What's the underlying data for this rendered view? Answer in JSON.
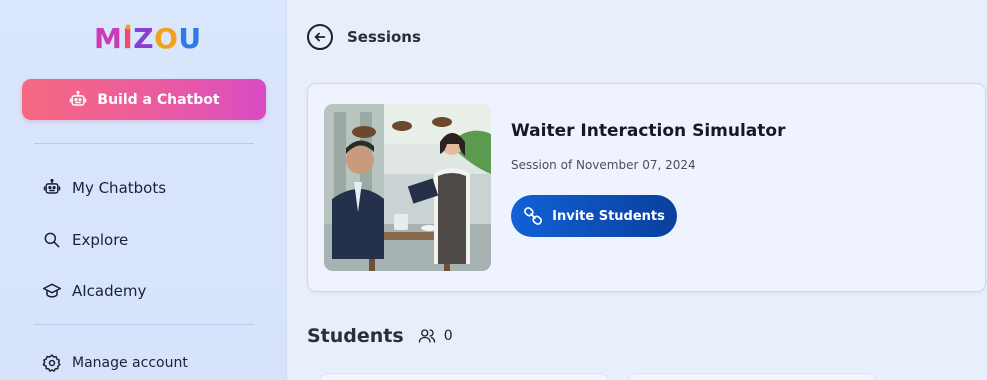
{
  "sidebar": {
    "logo": {
      "text": "MIZOU"
    },
    "build_button": {
      "label": "Build a Chatbot",
      "icon": "robot-icon"
    },
    "items": [
      {
        "label": "My Chatbots",
        "icon": "robot-icon"
      },
      {
        "label": "Explore",
        "icon": "search-icon"
      },
      {
        "label": "AIcademy",
        "icon": "graduation-cap-icon"
      },
      {
        "label": "Manage account",
        "icon": "gear-icon"
      }
    ]
  },
  "topbar": {
    "back_icon": "arrow-left-circle-icon",
    "title": "Sessions"
  },
  "session": {
    "title": "Waiter Interaction Simulator",
    "subtitle": "Session of November 07, 2024",
    "invite_label": "Invite Students",
    "invite_icon": "link-icon",
    "image": "restaurant-waiter-scene"
  },
  "students": {
    "heading": "Students",
    "icon": "users-icon",
    "count": "0"
  },
  "colors": {
    "build_gradient_start": "#f66980",
    "build_gradient_end": "#d94cc4",
    "invite_start": "#1161d6",
    "invite_end": "#0a3f9e",
    "sidebar_bg": "#d9e6fb",
    "main_bg": "#e9eefb"
  }
}
